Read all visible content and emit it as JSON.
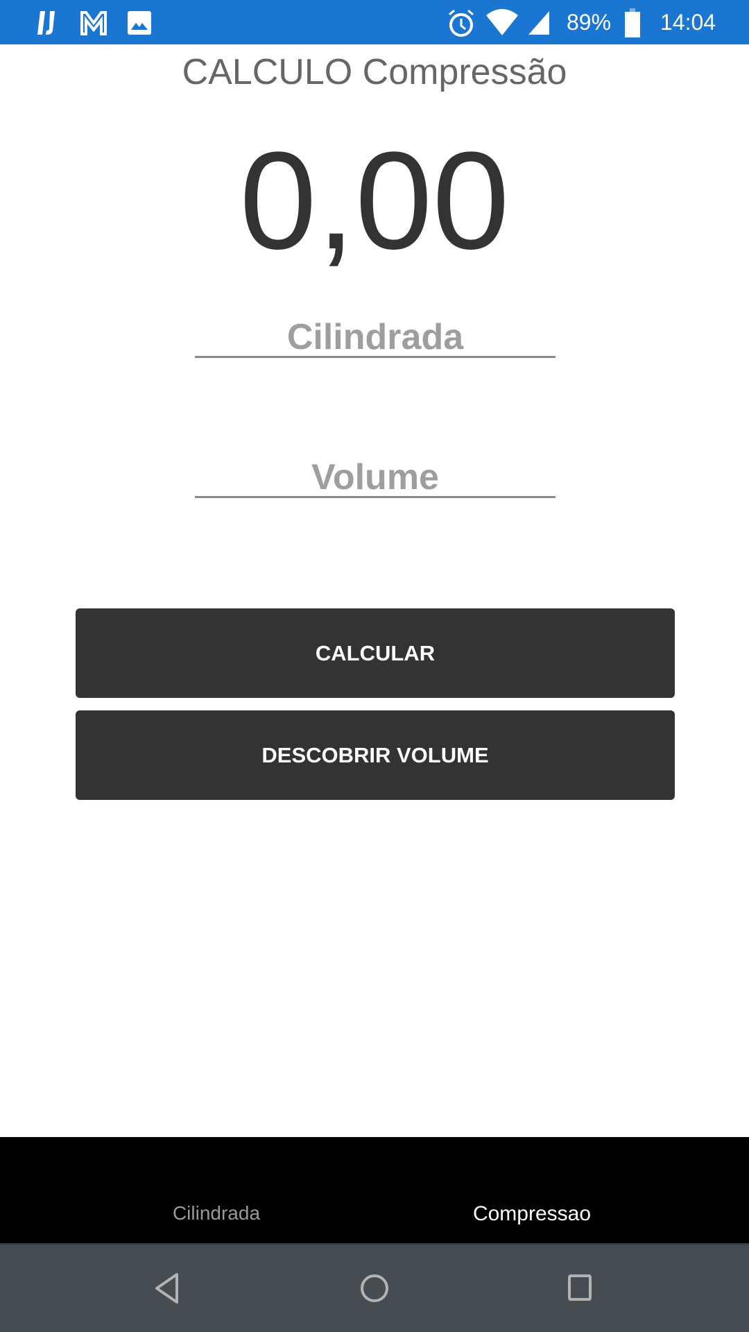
{
  "status_bar": {
    "battery": "89%",
    "time": "14:04",
    "icons": [
      "ij-app-icon",
      "gmail-icon",
      "image-icon",
      "alarm-icon",
      "wifi-icon",
      "signal-icon",
      "battery-icon"
    ],
    "color": "#1b76d2"
  },
  "title": "CALCULO Compressão",
  "result": "0,00",
  "inputs": {
    "cilindrada_placeholder": "Cilindrada",
    "volume_placeholder": "Volume"
  },
  "buttons": {
    "calcular": "CALCULAR",
    "descobrir": "DESCOBRIR VOLUME"
  },
  "tabs": [
    {
      "label": "Cilindrada",
      "active": false
    },
    {
      "label": "Compressao",
      "active": true
    }
  ],
  "nav": [
    "back-icon",
    "home-icon",
    "recents-icon"
  ]
}
